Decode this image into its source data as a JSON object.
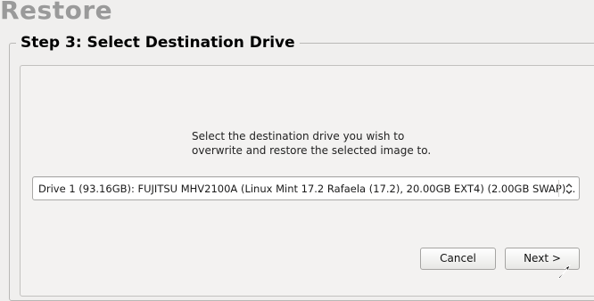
{
  "window": {
    "title": "Restore"
  },
  "step": {
    "title": "Step 3: Select Destination Drive"
  },
  "instruction": {
    "line1": "Select the destination drive you wish to",
    "line2": "overwrite and restore the selected image to."
  },
  "drive_select": {
    "selected_value": "Drive 1 (93.16GB): FUJITSU MHV2100A (Linux Mint 17.2 Rafaela (17.2), 20.00GB EXT4) (2.00GB SWAP)...",
    "icon": "updown-chevron-icon"
  },
  "buttons": {
    "cancel": "Cancel",
    "next": "Next >"
  },
  "colors": {
    "title_gray": "#9a9a9a",
    "background": "#f0efee",
    "border": "#b9b8b6"
  }
}
